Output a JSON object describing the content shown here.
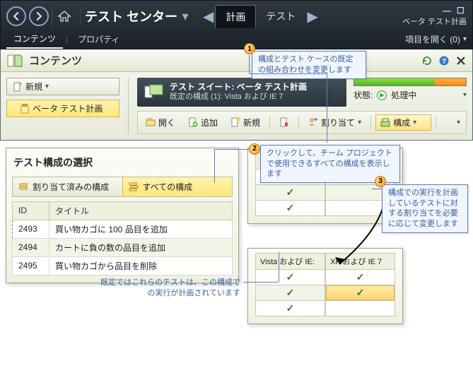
{
  "header": {
    "app_title": "テスト センター",
    "tabs": {
      "plan": "計画",
      "test": "テスト"
    },
    "plan_name": "ベータ テスト計画",
    "subtabs": {
      "contents": "コンテンツ",
      "properties": "プロパティ"
    },
    "open_items": "項目を開く (0)"
  },
  "ribbon": {
    "title": "コンテンツ",
    "new_btn": "新規",
    "tree_item": "ベータ テスト計画",
    "suite_title": "テスト スイート: ベータ テスト計画",
    "suite_sub": "既定の構成 (1): Vista および IE 7",
    "status_label": "状態:",
    "status_value": "処理中",
    "toolbar": {
      "open": "開く",
      "add": "追加",
      "new": "新規",
      "assign": "割り当て",
      "config": "構成"
    }
  },
  "callouts": {
    "c1": "構成とテスト ケースの既定の組み合わせを変更します",
    "c2": "クリックして、チーム プロジェクトで使用できるすべての構成を表示します",
    "c3": "構成での実行を計画しているテストに対する割り当てを必要に応じて変更します",
    "c4": "既定ではこれらのテストは、この構成での実行が計画されています"
  },
  "dialog": {
    "title": "テスト構成の選択",
    "filter_assigned": "割り当て済みの構成",
    "filter_all": "すべての構成",
    "cols": {
      "id": "ID",
      "title": "タイトル"
    },
    "rows": [
      {
        "id": "2493",
        "title": "買い物カゴに 100 品目を追加"
      },
      {
        "id": "2494",
        "title": "カートに負の数の品目を追加"
      },
      {
        "id": "2495",
        "title": "買い物カゴから品目を削除"
      }
    ]
  },
  "matrix": {
    "col1": "Vista および IE:",
    "col2": "XP および IE 7",
    "top": [
      [
        true,
        true
      ],
      [
        true,
        false
      ],
      [
        true,
        false
      ]
    ],
    "bottom": [
      [
        true,
        true
      ],
      [
        true,
        true
      ],
      [
        true,
        false
      ]
    ]
  }
}
